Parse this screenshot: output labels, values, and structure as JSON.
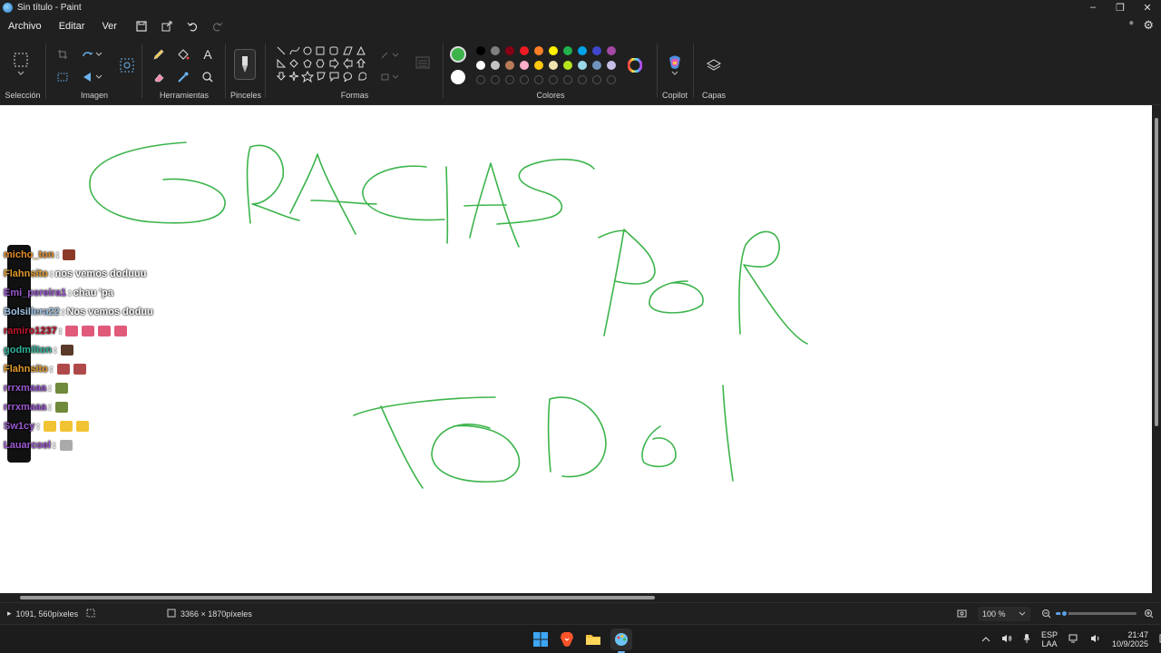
{
  "window": {
    "title": "Sin título - Paint"
  },
  "menu": {
    "items": [
      "Archivo",
      "Editar",
      "Ver"
    ]
  },
  "ribbon": {
    "groups": {
      "seleccion": "Selección",
      "imagen": "Imagen",
      "herramientas": "Herramientas",
      "pinceles": "Pinceles",
      "formas": "Formas",
      "colores": "Colores",
      "copilot": "Copilot",
      "capas": "Capas"
    },
    "colors": {
      "primary": "#3cb44b",
      "secondary": "#ffffff",
      "row1": [
        "#000000",
        "#7f7f7f",
        "#880015",
        "#ed1c24",
        "#ff7f27",
        "#fff200",
        "#22b14c",
        "#00a2e8",
        "#3f48cc",
        "#a349a4"
      ],
      "row2": [
        "#ffffff",
        "#c3c3c3",
        "#b97a57",
        "#ffaec9",
        "#ffc90e",
        "#efe4b0",
        "#b5e61d",
        "#99d9ea",
        "#7092be",
        "#c8bfe7"
      ]
    }
  },
  "drawing": {
    "stroke_color": "#3cb44b"
  },
  "chat": {
    "lines": [
      {
        "user": "micho_ton",
        "color": "#e58c2a",
        "msg": "",
        "emotes": [
          "#8b3a2a"
        ]
      },
      {
        "user": "Flahnsito",
        "color": "#e09a2b",
        "msg": "nos vemos doduuu",
        "emotes": []
      },
      {
        "user": "Emi_pereira1",
        "color": "#9b59d0",
        "msg": "chau 'pa",
        "emotes": []
      },
      {
        "user": "Bolsillera22",
        "color": "#9ec4e6",
        "msg": "Nos vemos doduu",
        "emotes": []
      },
      {
        "user": "ramiro1237",
        "color": "#c0142a",
        "msg": "",
        "emotes": [
          "#e05a7a",
          "#e05a7a",
          "#e05a7a",
          "#e05a7a"
        ]
      },
      {
        "user": "godmilton",
        "color": "#2fb39a",
        "msg": "",
        "emotes": [
          "#5a3a28"
        ]
      },
      {
        "user": "Flahnsito",
        "color": "#e09a2b",
        "msg": "",
        "emotes": [
          "#b04a4a",
          "#b04a4a"
        ]
      },
      {
        "user": "rrrxmaaa",
        "color": "#9b59d0",
        "msg": "",
        "emotes": [
          "#6f8a3a"
        ]
      },
      {
        "user": "rrrxmaaa",
        "color": "#9b59d0",
        "msg": "",
        "emotes": [
          "#6f8a3a"
        ]
      },
      {
        "user": "Sw1cy",
        "color": "#9b59d0",
        "msg": "",
        "emotes": [
          "#f1c232",
          "#f1c232",
          "#f1c232"
        ]
      },
      {
        "user": "Lauarcoel",
        "color": "#9b59d0",
        "msg": "",
        "emotes": [
          "#aaaaaa"
        ]
      }
    ]
  },
  "status": {
    "cursor": "1091, 560píxeles",
    "canvas_size": "3366 × 1870píxeles",
    "zoom": "100 %",
    "zoom_level": 0.1
  },
  "taskbar": {
    "lang1": "ESP",
    "lang2": "LAA",
    "time": "21:47",
    "date": "10/9/2025"
  }
}
